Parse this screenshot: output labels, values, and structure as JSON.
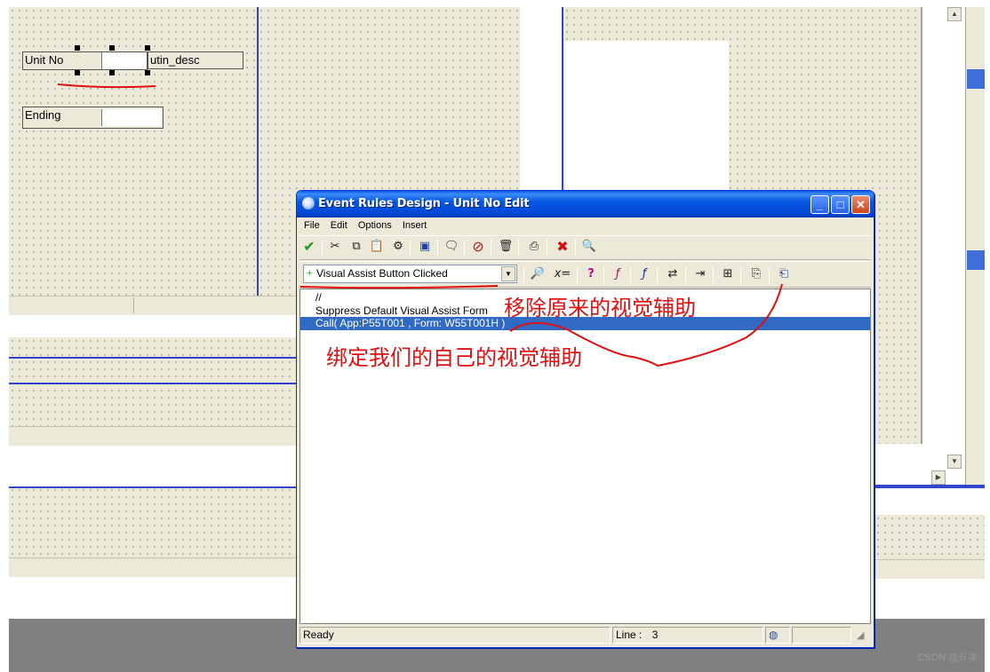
{
  "designer": {
    "fields": [
      {
        "label": "Unit No"
      },
      {
        "label": "Ending"
      }
    ],
    "desc_label": "utin_desc"
  },
  "window": {
    "title": "Event Rules Design - Unit No Edit",
    "menu": [
      "File",
      "Edit",
      "Options",
      "Insert"
    ],
    "title_buttons": {
      "minimize": "_",
      "maximize": "□",
      "close": "✕"
    },
    "event_combo": "Visual Assist Button Clicked",
    "code_lines": [
      "//",
      "Suppress Default Visual Assist Form",
      "Call( App:P55T001 , Form: W55T001H )"
    ],
    "status": {
      "text": "Ready",
      "line_label": "Line :",
      "line_value": "3"
    }
  },
  "annotations": {
    "remove": "移除原来的视觉辅助",
    "bind": "绑定我们的自己的视觉辅助"
  },
  "watermark": "CSDN @亓柒",
  "colors": {
    "annotation": "#e01010",
    "selection": "#316ac5",
    "title": "#0558e4"
  }
}
